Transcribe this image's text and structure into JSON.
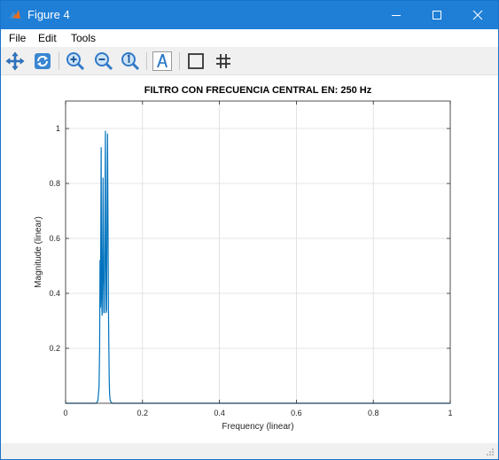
{
  "window": {
    "title": "Figure 4",
    "accent": "#1f7fd6"
  },
  "menu": [
    "File",
    "Edit",
    "Tools"
  ],
  "toolbar": {
    "tools": [
      "pan-icon",
      "rotate-icon",
      "zoom-in-icon",
      "zoom-out-icon",
      "zoom-reset-icon",
      "text-annotation-icon",
      "box-toggle-icon",
      "grid-toggle-icon"
    ]
  },
  "chart_data": {
    "type": "line",
    "title": "FILTRO CON FRECUENCIA CENTRAL EN:  250 Hz",
    "xlabel": "Frequency (linear)",
    "ylabel": "Magnitude (linear)",
    "xlim": [
      0,
      1
    ],
    "ylim": [
      0,
      1.1
    ],
    "xticks": [
      "0",
      "0.2",
      "0.4",
      "0.6",
      "0.8",
      "1"
    ],
    "yticks": [
      "0.2",
      "0.4",
      "0.6",
      "0.8",
      "1"
    ],
    "grid": true,
    "color": "#0072bd",
    "series": [
      {
        "x": [
          0,
          0.08,
          0.084,
          0.087,
          0.0885,
          0.0895,
          0.0905,
          0.0915,
          0.0925,
          0.0935,
          0.095,
          0.0965,
          0.0975,
          0.0985,
          0.0995,
          0.1005,
          0.102,
          0.1035,
          0.1045,
          0.1055,
          0.1065,
          0.1075,
          0.109,
          0.1105,
          0.1115,
          0.1125,
          0.1135,
          0.1145,
          0.116,
          0.119,
          0.123,
          1
        ],
        "y": [
          0,
          0,
          0.01,
          0.06,
          0.2,
          0.52,
          0.35,
          0.6,
          0.93,
          0.38,
          0.32,
          0.6,
          0.82,
          0.45,
          0.33,
          0.33,
          0.6,
          0.99,
          0.5,
          0.33,
          0.34,
          0.6,
          0.98,
          0.6,
          0.34,
          0.2,
          0.08,
          0.03,
          0.01,
          0.002,
          0,
          0
        ]
      }
    ]
  }
}
